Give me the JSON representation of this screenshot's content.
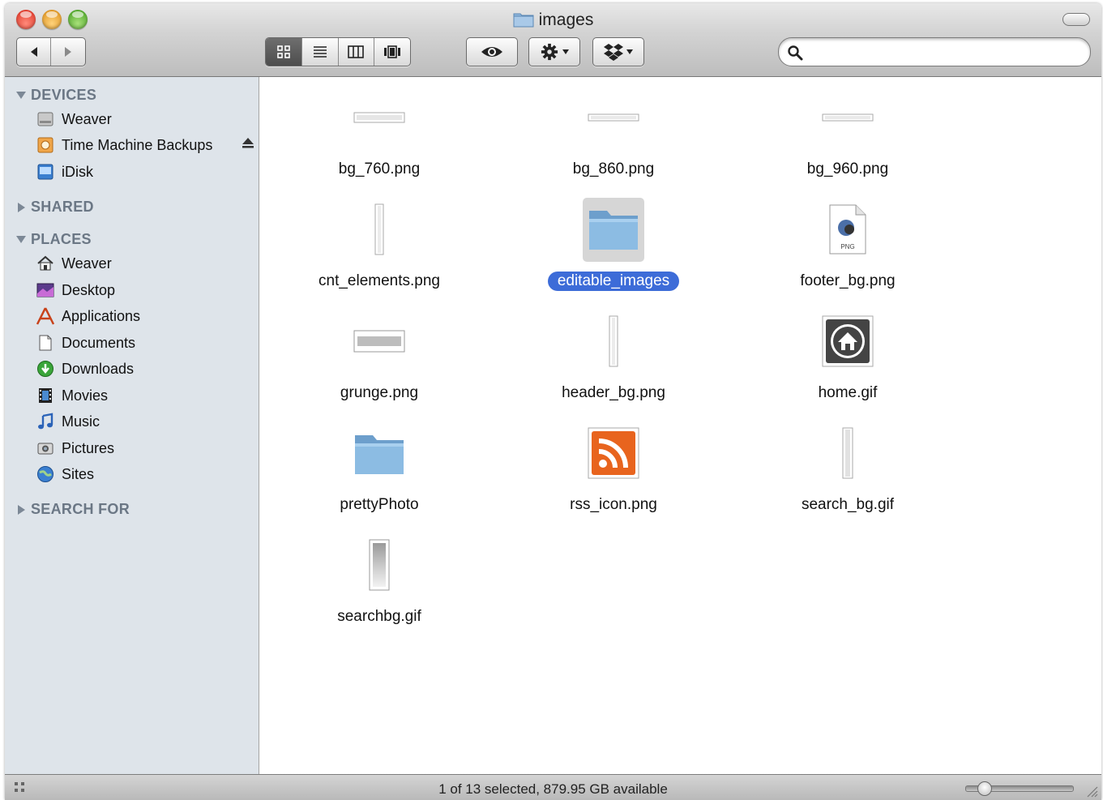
{
  "window": {
    "title": "images"
  },
  "toolbar": {
    "back_label": "◀",
    "forward_label": "▶",
    "view_buttons": [
      "icon-view",
      "list-view",
      "column-view",
      "coverflow-view"
    ],
    "active_view": "icon-view",
    "search": {
      "value": "",
      "placeholder": ""
    }
  },
  "sidebar": {
    "devices": {
      "heading": "DEVICES",
      "items": [
        {
          "label": "Weaver",
          "icon": "hard-drive-icon"
        },
        {
          "label": "Time Machine Backups",
          "icon": "time-machine-disk-icon"
        },
        {
          "label": "iDisk",
          "icon": "idisk-icon"
        }
      ]
    },
    "shared": {
      "heading": "SHARED"
    },
    "places": {
      "heading": "PLACES",
      "items": [
        {
          "label": "Weaver",
          "icon": "home-icon"
        },
        {
          "label": "Desktop",
          "icon": "desktop-icon"
        },
        {
          "label": "Applications",
          "icon": "applications-icon"
        },
        {
          "label": "Documents",
          "icon": "documents-icon"
        },
        {
          "label": "Downloads",
          "icon": "downloads-icon"
        },
        {
          "label": "Movies",
          "icon": "movies-icon"
        },
        {
          "label": "Music",
          "icon": "music-icon"
        },
        {
          "label": "Pictures",
          "icon": "pictures-icon"
        },
        {
          "label": "Sites",
          "icon": "sites-icon"
        }
      ]
    },
    "search_for": {
      "heading": "SEARCH FOR"
    }
  },
  "files": [
    {
      "name": "bg_760.png",
      "kind": "image-wide"
    },
    {
      "name": "bg_860.png",
      "kind": "image-wide"
    },
    {
      "name": "bg_960.png",
      "kind": "image-wide"
    },
    {
      "name": "cnt_elements.png",
      "kind": "image-tall"
    },
    {
      "name": "editable_images",
      "kind": "folder",
      "selected": true
    },
    {
      "name": "footer_bg.png",
      "kind": "png-document"
    },
    {
      "name": "grunge.png",
      "kind": "image-box"
    },
    {
      "name": "header_bg.png",
      "kind": "image-tall"
    },
    {
      "name": "home.gif",
      "kind": "home-image"
    },
    {
      "name": "prettyPhoto",
      "kind": "folder"
    },
    {
      "name": "rss_icon.png",
      "kind": "rss-image"
    },
    {
      "name": "search_bg.gif",
      "kind": "image-tall"
    },
    {
      "name": "searchbg.gif",
      "kind": "image-gradient"
    }
  ],
  "status": {
    "text": "1 of 13 selected, 879.95 GB available",
    "icon_size_level": 0.12
  },
  "colors": {
    "selection": "#3d6cd8",
    "sidebar_bg": "#dee4ea",
    "sidebar_heading": "#6b7785"
  }
}
